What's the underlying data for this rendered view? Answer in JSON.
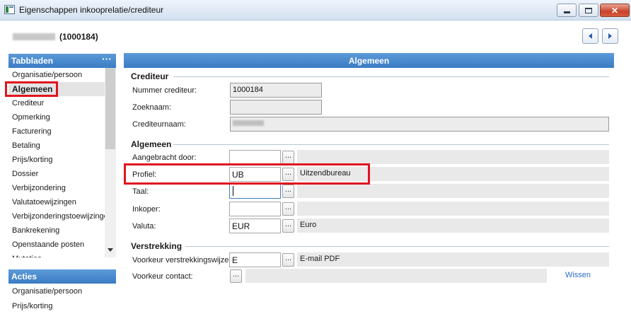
{
  "window": {
    "title": "Eigenschappen inkooprelatie/crediteur",
    "min_icon": "minimize-icon",
    "max_icon": "maximize-icon",
    "close_label": "✕"
  },
  "header": {
    "record_id": "(1000184)",
    "prev_icon": "chevron-left-icon",
    "next_icon": "chevron-right-icon"
  },
  "tabbladen": {
    "title": "Tabbladen",
    "more_label": "···",
    "items": [
      "Organisatie/persoon",
      "Algemeen",
      "Crediteur",
      "Opmerking",
      "Facturering",
      "Betaling",
      "Prijs/korting",
      "Dossier",
      "Verbijzondering",
      "Valutatoewijzingen",
      "Verbijzonderingstoewijzingen",
      "Bankrekening",
      "Openstaande posten",
      "Mutaties"
    ],
    "selected_index": 1
  },
  "acties": {
    "title": "Acties",
    "items": [
      "Organisatie/persoon",
      "Prijs/korting"
    ]
  },
  "main": {
    "section_title": "Algemeen",
    "crediteur": {
      "title": "Crediteur",
      "nummer_label": "Nummer crediteur:",
      "nummer_value": "1000184",
      "zoeknaam_label": "Zoeknaam:",
      "zoeknaam_value": "",
      "crediteurnaam_label": "Crediteurnaam:"
    },
    "algemeen": {
      "title": "Algemeen",
      "aangebracht_label": "Aangebracht door:",
      "aangebracht_value": "",
      "profiel_label": "Profiel:",
      "profiel_value": "UB",
      "profiel_desc": "Uitzendbureau",
      "taal_label": "Taal:",
      "taal_value": "",
      "inkoper_label": "Inkoper:",
      "inkoper_value": "",
      "valuta_label": "Valuta:",
      "valuta_value": "EUR",
      "valuta_desc": "Euro"
    },
    "verstrekking": {
      "title": "Verstrekking",
      "voorkeur_wijze_label": "Voorkeur verstrekkingswijze:",
      "voorkeur_wijze_value": "E",
      "voorkeur_wijze_desc": "E-mail PDF",
      "voorkeur_contact_label": "Voorkeur contact:",
      "wissen_label": "Wissen"
    },
    "lookup_label": "..."
  },
  "colors": {
    "accent": "#3a7cc4",
    "highlight": "#e0141e"
  }
}
